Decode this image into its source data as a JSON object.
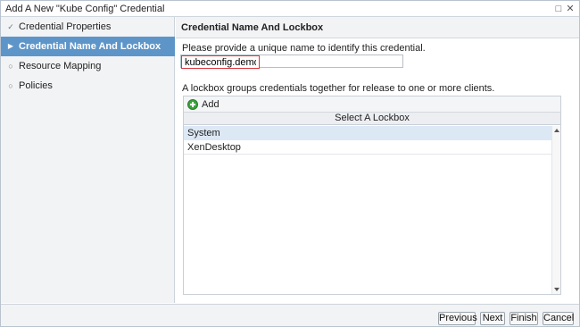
{
  "window": {
    "title": "Add A New \"Kube Config\" Credential",
    "restore_glyph": "□",
    "close_glyph": "✕"
  },
  "sidebar": {
    "items": [
      {
        "label": "Credential Properties",
        "state": "done",
        "marker": "✓"
      },
      {
        "label": "Credential Name And Lockbox",
        "state": "active",
        "marker": "▶"
      },
      {
        "label": "Resource Mapping",
        "state": "pending",
        "marker": "○"
      },
      {
        "label": "Policies",
        "state": "pending",
        "marker": "○"
      }
    ]
  },
  "main": {
    "heading": "Credential Name And Lockbox",
    "name_prompt": "Please provide a unique name to identify this credential.",
    "name_value": "kubeconfig.demo",
    "lockbox_description": "A lockbox groups credentials together for release to one or more clients.",
    "grid": {
      "add_label": "Add",
      "column_header": "Select A Lockbox",
      "rows": [
        {
          "label": "System",
          "selected": true
        },
        {
          "label": "XenDesktop",
          "selected": false
        }
      ]
    }
  },
  "footer": {
    "previous_label": "Previous",
    "next_label": "Next",
    "finish_label": "Finish",
    "cancel_label": "Cancel"
  },
  "colors": {
    "active_step": "#5e95c9",
    "selected_row": "#dde8f5",
    "input_highlight": "#d9363e",
    "add_icon": "#3aa33a"
  }
}
